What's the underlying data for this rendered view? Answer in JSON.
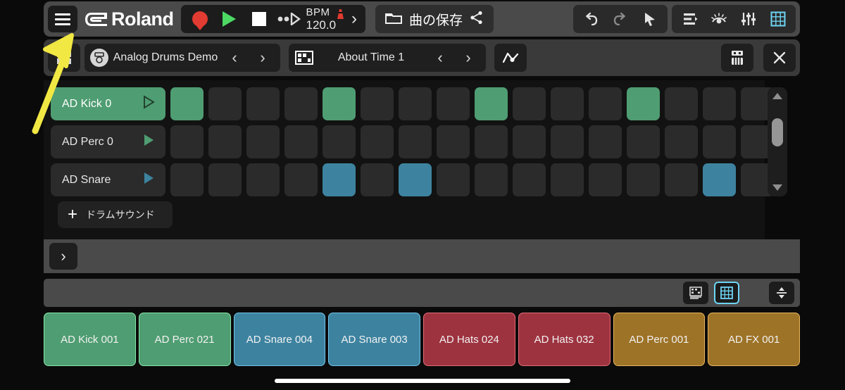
{
  "app": {
    "brand": "Roland",
    "brand_mark": "roland-logo-icon"
  },
  "toolbar": {
    "menu_icon": "hamburger-menu-icon",
    "record_icon": "record-icon",
    "play_icon": "play-icon",
    "stop_icon": "stop-icon",
    "loop_icon": "fast-forward-icon",
    "bpm_label": "BPM",
    "bpm_value": "120.0",
    "metronome_icon": "metronome-icon",
    "bpm_expand_icon": "chevron-right-icon",
    "folder_icon": "folder-icon",
    "save_label": "曲の保存",
    "share_icon": "share-icon",
    "undo_icon": "undo-icon",
    "redo_icon": "redo-icon",
    "pointer_icon": "pointer-arrow-icon",
    "mixer_list_icon": "track-list-icon",
    "eye_icon": "eye-icon",
    "faders_icon": "sliders-icon",
    "grid_icon": "grid-icon",
    "accent_color": "#6ed4f5"
  },
  "row2": {
    "view_icon": "four-square-view-icon",
    "kit_icon": "drum-kit-icon",
    "kit_name": "Analog Drums Demo",
    "prev_icon": "chevron-left-icon",
    "next_icon": "chevron-right-icon",
    "pattern_icon": "pattern-grid-icon",
    "pattern_name": "About Time 1",
    "pattern_prev_icon": "chevron-left-icon",
    "pattern_next_icon": "chevron-right-icon",
    "automation_icon": "automation-curve-icon",
    "keyboard_icon": "keyboard-icon",
    "close_icon": "close-icon"
  },
  "sequencer": {
    "steps": 16,
    "rows": [
      {
        "label": "AD Kick 0",
        "selected": true,
        "color": "#4f9d72",
        "steps": [
          1,
          0,
          0,
          0,
          1,
          0,
          0,
          0,
          1,
          0,
          0,
          0,
          1,
          0,
          0,
          0
        ]
      },
      {
        "label": "AD Perc 0",
        "selected": false,
        "color": "#4f9d72",
        "steps": [
          0,
          0,
          0,
          0,
          0,
          0,
          0,
          0,
          0,
          0,
          0,
          0,
          0,
          0,
          0,
          0
        ]
      },
      {
        "label": "AD Snare",
        "selected": false,
        "color": "#3d83a0",
        "steps": [
          0,
          0,
          0,
          0,
          1,
          0,
          1,
          0,
          0,
          0,
          0,
          0,
          0,
          0,
          1,
          0
        ]
      }
    ],
    "add_sound_label": "ドラムサウンド",
    "add_sound_plus": "+",
    "scroll_up_icon": "scroll-up-arrow-icon",
    "scroll_down_icon": "scroll-down-arrow-icon",
    "empty_cell_color": "#2b2b2b"
  },
  "strip": {
    "expand_icon": "chevron-right-icon"
  },
  "padbar": {
    "pianoroll_icon": "piano-roll-icon",
    "grid_view_icon": "pad-grid-icon",
    "resize_icon": "vertical-resize-icon",
    "active_view": "pad-grid-icon"
  },
  "pads": [
    {
      "label": "AD Kick 001",
      "fill": "#4f9d72",
      "border": "#85e8a8"
    },
    {
      "label": "AD Perc 021",
      "fill": "#4f9d72",
      "border": "#85e8a8"
    },
    {
      "label": "AD Snare 004",
      "fill": "#3d83a0",
      "border": "#6fc4ea"
    },
    {
      "label": "AD Snare 003",
      "fill": "#3d83a0",
      "border": "#6fc4ea"
    },
    {
      "label": "AD Hats 024",
      "fill": "#9e3340",
      "border": "#e06b78"
    },
    {
      "label": "AD Hats 032",
      "fill": "#9e3340",
      "border": "#e06b78"
    },
    {
      "label": "AD Perc 001",
      "fill": "#9d7327",
      "border": "#e8b45e"
    },
    {
      "label": "AD FX 001",
      "fill": "#9d7327",
      "border": "#e8b45e"
    }
  ],
  "annotation": {
    "type": "arrow",
    "color": "#f2e843",
    "points_to": "hamburger-menu-icon"
  }
}
